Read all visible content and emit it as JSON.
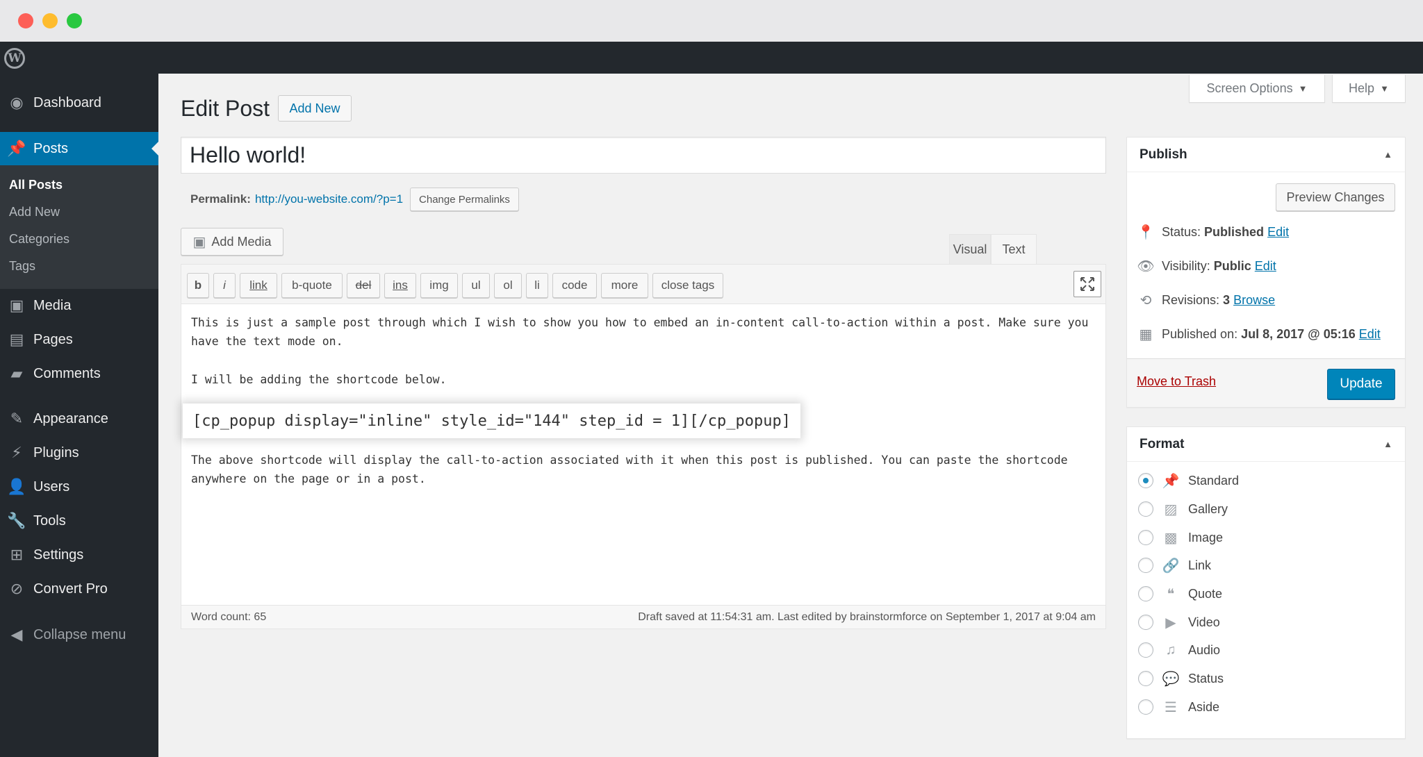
{
  "sidebar": {
    "menu": [
      {
        "label": "Dashboard",
        "icon": "dashboard-icon"
      },
      {
        "label": "Posts",
        "icon": "pin-icon"
      },
      {
        "label": "Media",
        "icon": "media-icon"
      },
      {
        "label": "Pages",
        "icon": "pages-icon"
      },
      {
        "label": "Comments",
        "icon": "comments-icon"
      },
      {
        "label": "Appearance",
        "icon": "appearance-icon"
      },
      {
        "label": "Plugins",
        "icon": "plugins-icon"
      },
      {
        "label": "Users",
        "icon": "users-icon"
      },
      {
        "label": "Tools",
        "icon": "tools-icon"
      },
      {
        "label": "Settings",
        "icon": "settings-icon"
      },
      {
        "label": "Convert Pro",
        "icon": "convert-pro-icon"
      },
      {
        "label": "Collapse menu",
        "icon": "collapse-icon"
      }
    ],
    "posts_submenu": [
      "All Posts",
      "Add New",
      "Categories",
      "Tags"
    ]
  },
  "header": {
    "screen_options": "Screen Options",
    "help": "Help",
    "page_title": "Edit Post",
    "add_new": "Add New"
  },
  "post": {
    "title": "Hello world!",
    "permalink_label": "Permalink:",
    "permalink_url": "http://you-website.com/?p=1",
    "change_permalinks": "Change Permalinks"
  },
  "editor": {
    "add_media": "Add Media",
    "tabs": [
      "Visual",
      "Text"
    ],
    "active_tab": "Text",
    "quicktags": [
      "b",
      "i",
      "link",
      "b-quote",
      "del",
      "ins",
      "img",
      "ul",
      "ol",
      "li",
      "code",
      "more",
      "close tags"
    ],
    "paragraphs": [
      "This is just a sample post through which I wish to show you how to embed an in-content call-to-action within a post. Make sure you have the text mode on.",
      "I will be adding the shortcode below.",
      "The above shortcode will display the call-to-action associated with it when this post is published. You can paste the shortcode anywhere on the page or in a post."
    ],
    "shortcode": "[cp_popup display=\"inline\" style_id=\"144\" step_id = 1][/cp_popup]",
    "word_count": "Word count: 65",
    "draft_status": "Draft saved at 11:54:31 am. Last edited by brainstormforce on September 1, 2017 at 9:04 am"
  },
  "publish": {
    "heading": "Publish",
    "preview": "Preview Changes",
    "status_label": "Status:",
    "status_value": "Published",
    "visibility_label": "Visibility:",
    "visibility_value": "Public",
    "revisions_label": "Revisions:",
    "revisions_value": "3",
    "browse": "Browse",
    "published_label": "Published on:",
    "published_value": "Jul 8, 2017 @ 05:16",
    "edit": "Edit",
    "trash": "Move to Trash",
    "update": "Update"
  },
  "format": {
    "heading": "Format",
    "options": [
      {
        "label": "Standard",
        "icon": "pin-icon",
        "checked": true
      },
      {
        "label": "Gallery",
        "icon": "gallery-icon",
        "checked": false
      },
      {
        "label": "Image",
        "icon": "image-icon",
        "checked": false
      },
      {
        "label": "Link",
        "icon": "link-icon",
        "checked": false
      },
      {
        "label": "Quote",
        "icon": "quote-icon",
        "checked": false
      },
      {
        "label": "Video",
        "icon": "video-icon",
        "checked": false
      },
      {
        "label": "Audio",
        "icon": "audio-icon",
        "checked": false
      },
      {
        "label": "Status",
        "icon": "status-icon",
        "checked": false
      },
      {
        "label": "Aside",
        "icon": "aside-icon",
        "checked": false
      }
    ]
  },
  "colors": {
    "accent": "#0073aa",
    "sidebar_bg": "#23282d",
    "update_button": "#0085ba",
    "trash": "#a00"
  }
}
